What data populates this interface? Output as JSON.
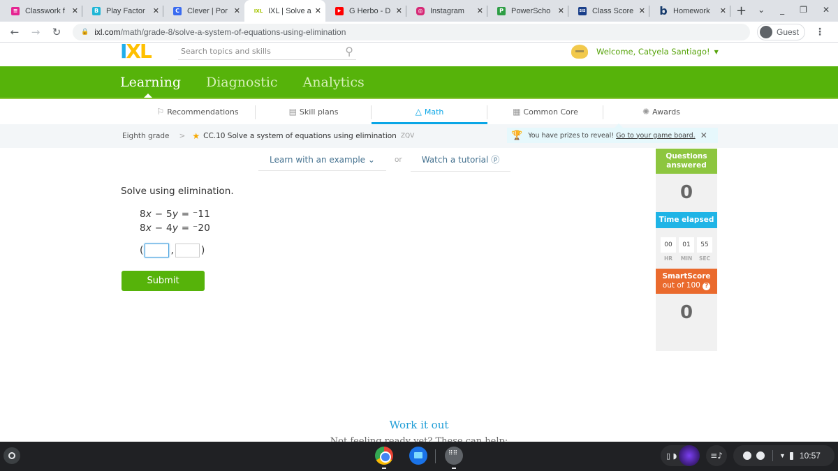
{
  "browser": {
    "tabs": [
      {
        "title": "Classwork f",
        "favicon": "classroom-icon",
        "color": "#e52592",
        "glyph": "≡"
      },
      {
        "title": "Play Factor",
        "favicon": "blooket-icon",
        "color": "#1fb6d6",
        "glyph": "B"
      },
      {
        "title": "Clever | Por",
        "favicon": "clever-icon",
        "color": "#3a6bf0",
        "glyph": "C"
      },
      {
        "title": "IXL | Solve a",
        "favicon": "ixl-icon",
        "color": "#ffc000",
        "glyph": "IXL",
        "active": true
      },
      {
        "title": "G Herbo - D",
        "favicon": "youtube-icon",
        "color": "#ff0000",
        "glyph": "▶"
      },
      {
        "title": "Instagram",
        "favicon": "instagram-icon",
        "color": "#d62976",
        "glyph": "◎"
      },
      {
        "title": "PowerScho",
        "favicon": "powerschool-icon",
        "color": "#2e9e45",
        "glyph": "P"
      },
      {
        "title": "Class Score",
        "favicon": "sis-icon",
        "color": "#1a3f8a",
        "glyph": "SIS"
      },
      {
        "title": "Homework",
        "favicon": "brainly-icon",
        "color": "#163a6b",
        "glyph": "b"
      }
    ],
    "new_tab": "+",
    "url_host": "ixl.com",
    "url_path": "/math/grade-8/solve-a-system-of-equations-using-elimination",
    "profile": "Guest"
  },
  "header": {
    "logo_i": "I",
    "logo_xl": "XL",
    "search_placeholder": "Search topics and skills",
    "welcome": "Welcome, Catyela Santiago!"
  },
  "main_nav": [
    {
      "label": "Learning",
      "active": true
    },
    {
      "label": "Diagnostic"
    },
    {
      "label": "Analytics"
    }
  ],
  "sub_nav": [
    {
      "label": "Recommendations",
      "icon": "signpost-icon"
    },
    {
      "label": "Skill plans",
      "icon": "skill-plan-icon"
    },
    {
      "label": "Math",
      "icon": "pyramid-icon",
      "active": true
    },
    {
      "label": "Common Core",
      "icon": "clipboard-icon"
    },
    {
      "label": "Awards",
      "icon": "confetti-icon"
    }
  ],
  "breadcrumb": {
    "grade": "Eighth grade",
    "skill": "CC.10 Solve a system of equations using elimination",
    "code": "ZQV"
  },
  "prize_banner": {
    "text": "You have prizes to reveal!",
    "link": "Go to your game board."
  },
  "learn": {
    "example": "Learn with an example",
    "or": "or",
    "tutorial": "Watch a tutorial"
  },
  "question": {
    "prompt": "Solve using elimination.",
    "eq1": {
      "a": "8",
      "x": "x",
      "op": " − 5",
      "y": "y",
      "rhs": " = ⁻11"
    },
    "eq2": {
      "a": "8",
      "x": "x",
      "op": " − 4",
      "y": "y",
      "rhs": " = ⁻20"
    },
    "open_paren": "(",
    "comma": ",",
    "close_paren": ")",
    "x_value": "",
    "y_value": ""
  },
  "submit_label": "Submit",
  "stats": {
    "questions_label": "Questions answered",
    "questions_value": "0",
    "time_label": "Time elapsed",
    "hr": "00",
    "min": "01",
    "sec": "55",
    "hr_label": "HR",
    "min_label": "MIN",
    "sec_label": "SEC",
    "smartscore_label": "SmartScore",
    "smartscore_sub": "out of 100",
    "smartscore_value": "0"
  },
  "footer": {
    "work_it_out": "Work it out",
    "not_ready": "Not feeling ready yet? These can help:"
  },
  "shelf": {
    "time": "10:57"
  }
}
